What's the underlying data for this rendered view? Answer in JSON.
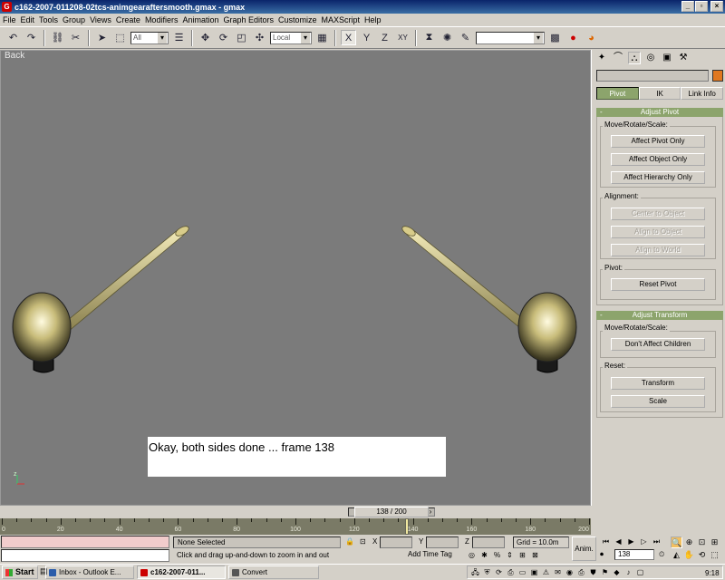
{
  "window": {
    "title": "c162-2007-011208-02tcs-animgearaftersmooth.gmax - gmax",
    "minimize": "_",
    "maximize": "▫",
    "close": "×"
  },
  "menu": [
    "File",
    "Edit",
    "Tools",
    "Group",
    "Views",
    "Create",
    "Modifiers",
    "Animation",
    "Graph Editors",
    "Customize",
    "MAXScript",
    "Help"
  ],
  "toolbar": {
    "selection_filter": "All",
    "coord_system": "Local",
    "axis_x": "X",
    "axis_y": "Y",
    "axis_z": "Z",
    "axis_xy": "XY"
  },
  "viewport": {
    "label": "Back",
    "caption": "Okay, both sides done ... frame 138",
    "axis_label": "z",
    "colors": {
      "background": "#7b7b7b",
      "gear": "#d8cc8a",
      "tire": "#1a1a1a"
    }
  },
  "time_slider": {
    "label": "138 / 200",
    "current_frame": 138,
    "total_frames": 200
  },
  "trackbar": {
    "ticks": [
      "0",
      "20",
      "40",
      "60",
      "80",
      "100",
      "120",
      "140",
      "160",
      "180",
      "200"
    ]
  },
  "status": {
    "selection": "None Selected",
    "prompt": "Click and drag up-and-down to zoom in and out",
    "x_label": "X",
    "y_label": "Y",
    "z_label": "Z",
    "grid": "Grid = 10.0m",
    "add_time_tag": "Add Time Tag",
    "anim_button": "Anim.",
    "frame": "138"
  },
  "command_panel": {
    "tabs": [
      {
        "name": "create-icon",
        "glyph": "✦"
      },
      {
        "name": "modify-icon",
        "glyph": "⌒"
      },
      {
        "name": "hierarchy-icon",
        "glyph": "⛬"
      },
      {
        "name": "motion-icon",
        "glyph": "◎"
      },
      {
        "name": "display-icon",
        "glyph": "▣"
      },
      {
        "name": "utilities-icon",
        "glyph": "⚒"
      }
    ],
    "subtabs": [
      "Pivot",
      "IK",
      "Link Info"
    ],
    "adjust_pivot": {
      "title": "Adjust Pivot",
      "move_group": "Move/Rotate/Scale:",
      "affect_pivot_only": "Affect Pivot Only",
      "affect_object_only": "Affect Object Only",
      "affect_hierarchy_only": "Affect Hierarchy Only",
      "alignment_group": "Alignment:",
      "center_to_object": "Center to Object",
      "align_to_object": "Align to Object",
      "align_to_world": "Align to World",
      "pivot_group": "Pivot:",
      "reset_pivot": "Reset Pivot"
    },
    "adjust_transform": {
      "title": "Adjust Transform",
      "move_group": "Move/Rotate/Scale:",
      "dont_affect_children": "Don't Affect Children",
      "reset_group": "Reset:",
      "transform": "Transform",
      "scale": "Scale"
    }
  },
  "taskbar": {
    "start": "Start",
    "tasks": [
      "Inbox - Outlook E...",
      "c162-2007-011...",
      "Convert"
    ],
    "clock": "9:18 AM"
  }
}
